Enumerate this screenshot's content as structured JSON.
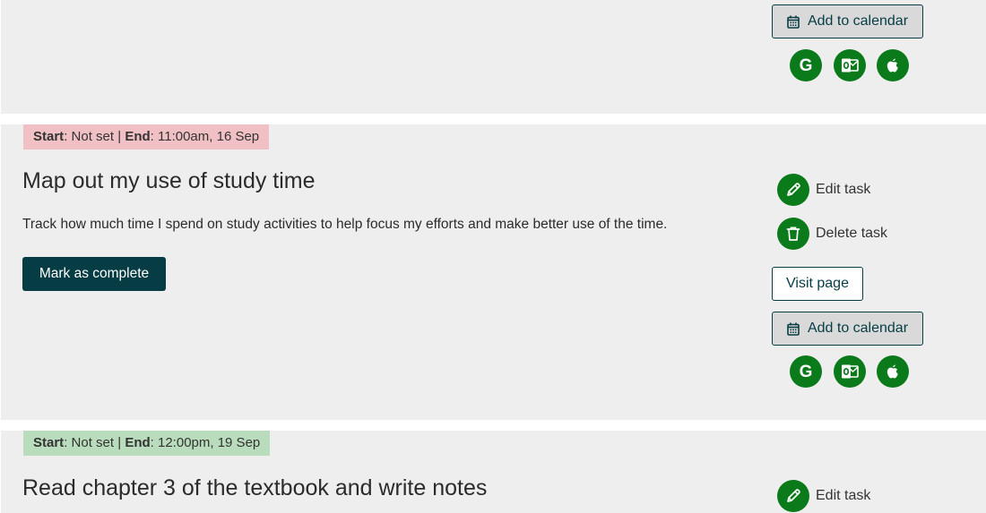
{
  "labels": {
    "start": "Start",
    "end": "End",
    "separator": "|",
    "colon": ":"
  },
  "cards": [
    {
      "add_to_calendar": "Add to calendar"
    },
    {
      "start_value": "Not set",
      "end_value": "11:00am, 16 Sep",
      "status": "overdue",
      "title": "Map out my use of study time",
      "description": "Track how much time I spend on study activities to help focus my efforts and make better use of the time.",
      "mark_complete": "Mark as complete",
      "edit": "Edit task",
      "delete": "Delete task",
      "visit": "Visit page",
      "add_to_calendar": "Add to calendar"
    },
    {
      "start_value": "Not set",
      "end_value": "12:00pm, 19 Sep",
      "status": "upcoming",
      "title": "Read chapter 3 of the textbook and write notes",
      "edit": "Edit task"
    }
  ],
  "calendar_icons": {
    "google_letter": "G",
    "icons": [
      "google-calendar-icon",
      "outlook-icon",
      "apple-icon"
    ]
  },
  "colors": {
    "accent_green": "#0b7a1a",
    "dark_teal": "#063d45",
    "card_background": "#eeeeee",
    "overdue_badge": "#f0c0c4",
    "upcoming_badge": "#b9dcbc"
  }
}
